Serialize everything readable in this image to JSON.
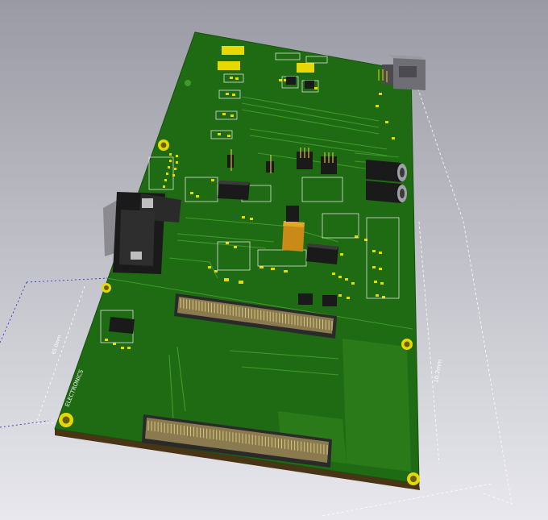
{
  "scene": {
    "background_top": "#9a9aa4",
    "background_bottom": "#e8e8ee",
    "board_color": "#1f6b13",
    "board_edge_color": "#4a3416",
    "copper_trace_color": "#3f9a2a",
    "pad_color": "#e6d800",
    "silkscreen_color": "#f2f2f2",
    "dimension_line_color": "#3a3ab8"
  },
  "annotations": {
    "board_label": "ELECTRONICS",
    "dimension_right_value": "10.2mm",
    "dimension_left_value": "65.0mm"
  },
  "components": [
    {
      "name": "db9-serial-connector",
      "kind": "connector"
    },
    {
      "name": "rj-ethernet-jack",
      "kind": "connector"
    },
    {
      "name": "audio-jack-top",
      "kind": "connector"
    },
    {
      "name": "audio-jack-bottom",
      "kind": "connector"
    },
    {
      "name": "header-connector-upper",
      "kind": "header"
    },
    {
      "name": "header-connector-lower",
      "kind": "header"
    },
    {
      "name": "ic-chip-central",
      "kind": "ic"
    },
    {
      "name": "ic-chip-right",
      "kind": "ic"
    },
    {
      "name": "ic-chip-left",
      "kind": "ic"
    },
    {
      "name": "tantalum-capacitor",
      "kind": "capacitor"
    }
  ]
}
